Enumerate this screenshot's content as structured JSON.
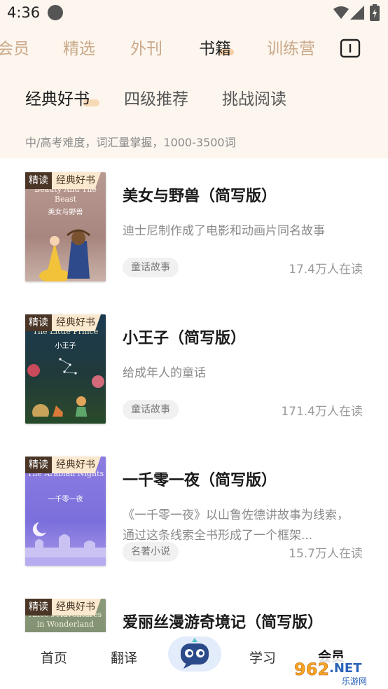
{
  "status_bar": {
    "time": "4:36",
    "icons": [
      "circle-icon",
      "wifi-icon",
      "signal-icon",
      "battery-icon"
    ]
  },
  "main_tabs": [
    {
      "label": "会员",
      "active": false
    },
    {
      "label": "精选",
      "active": false
    },
    {
      "label": "外刊",
      "active": false
    },
    {
      "label": "书籍",
      "active": true
    },
    {
      "label": "训练营",
      "active": false
    }
  ],
  "header_icon": "book-icon",
  "sub_tabs": [
    {
      "label": "经典好书",
      "active": true
    },
    {
      "label": "四级推荐",
      "active": false
    },
    {
      "label": "挑战阅读",
      "active": false
    }
  ],
  "level_description": "中/高考难度，词汇量掌握，1000-3500词",
  "books": [
    {
      "badge_a": "精读",
      "badge_b": "经典好书",
      "cover_en": "Beauty And The Beast",
      "cover_cn": "美女与野兽",
      "title": "美女与野兽（简写版）",
      "description": "迪士尼制作成了电影和动画片同名故事",
      "tag": "童话故事",
      "readers": "17.4万人在读"
    },
    {
      "badge_a": "精读",
      "badge_b": "经典好书",
      "cover_en": "The Little Prince",
      "cover_cn": "小王子",
      "title": "小王子（简写版）",
      "description": "给成年人的童话",
      "tag": "童话故事",
      "readers": "171.4万人在读"
    },
    {
      "badge_a": "精读",
      "badge_b": "经典好书",
      "cover_en": "The Arabian Nights",
      "cover_cn": "一千零一夜",
      "title": "一千零一夜（简写版）",
      "description": "《一千零一夜》以山鲁佐德讲故事为线索，通过这条线索全书形成了一个框架...",
      "tag": "名著小说",
      "readers": "15.7万人在读"
    },
    {
      "badge_a": "精读",
      "badge_b": "经典好书",
      "cover_en": "Alice's Adventures in Wonderland",
      "title": "爱丽丝漫游奇境记（简写版）"
    }
  ],
  "bottom_nav": [
    {
      "label": "首页"
    },
    {
      "label": "翻译"
    },
    {
      "label": "",
      "icon": "chat-bot-icon"
    },
    {
      "label": "学习"
    },
    {
      "label": "会员",
      "active": true
    }
  ],
  "watermark": {
    "text": "962.NET",
    "subtext": "乐游网"
  },
  "colors": {
    "top_background": "#fdf6ee",
    "tab_inactive": "#c9a98a",
    "highlight": "#f4cfa3",
    "badge_dark": "#4a3526",
    "badge_light": "#fbe9cf"
  }
}
